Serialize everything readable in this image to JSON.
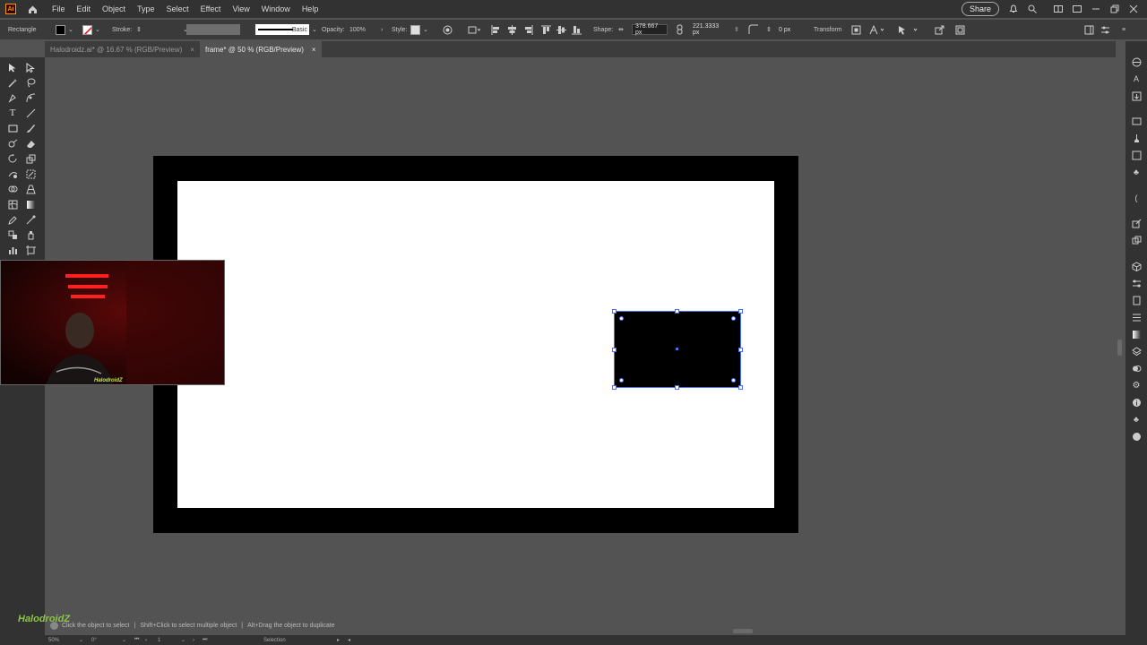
{
  "app": {
    "logo": "Ai"
  },
  "menu": [
    "File",
    "Edit",
    "Object",
    "Type",
    "Select",
    "Effect",
    "View",
    "Window",
    "Help"
  ],
  "topright": {
    "share": "Share"
  },
  "control": {
    "object_type": "Rectangle",
    "stroke_label": "Stroke:",
    "brush": "Basic",
    "opacity_label": "Opacity:",
    "opacity_value": "100%",
    "style_label": "Style:",
    "shape_label": "Shape:",
    "width_value": "378.667 px",
    "height_value": "221.3333 px",
    "corner_value": "0 px",
    "transform_label": "Transform"
  },
  "tabs": [
    {
      "label": "Halodroidz.ai* @ 16.67 % (RGB/Preview)",
      "close": "×"
    },
    {
      "label": "frame* @ 50 % (RGB/Preview)",
      "close": "×"
    }
  ],
  "status": {
    "zoom": "50%",
    "rotation": "0°",
    "artboard": "1",
    "mode": "Selection",
    "hint1": "Click the object to select",
    "hint2": "Shift+Click to select multiple object",
    "hint3": "Alt+Drag the object to duplicate"
  },
  "webcam": {
    "caption": "HalodroidZ"
  },
  "watermark": "HalodroidZ",
  "colors": {
    "accent": "#4a6cff",
    "panel": "#323232",
    "canvas": "#535353"
  }
}
